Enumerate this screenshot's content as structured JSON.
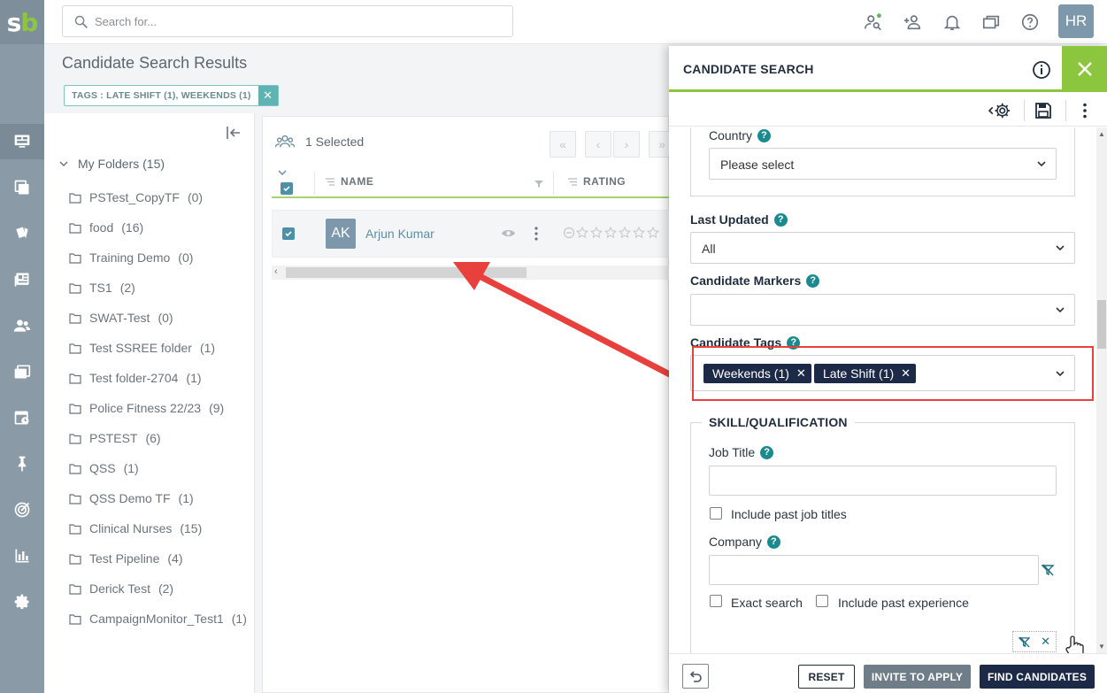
{
  "app": {
    "logo_text": "sb"
  },
  "header": {
    "search_placeholder": "Search for...",
    "user_initials": "HR",
    "icons": [
      "people-search-icon",
      "add-person-icon",
      "bell-icon",
      "windows-icon",
      "help-icon"
    ]
  },
  "nav": {
    "items": [
      "dashboard-icon",
      "copy-icon",
      "cards-icon",
      "news-icon",
      "people-icon",
      "folders-icon",
      "calendar-clock-icon",
      "pin-icon",
      "target-icon",
      "chart-icon",
      "gear-icon"
    ],
    "active_index": 0
  },
  "page": {
    "title": "Candidate Search Results",
    "filter_chip": "TAGS : LATE SHIFT (1), WEEKENDS (1)"
  },
  "folders": {
    "root_label": "My Folders",
    "root_count": "(15)",
    "items": [
      {
        "name": "PSTest_CopyTF",
        "count": "(0)"
      },
      {
        "name": "food",
        "count": "(16)"
      },
      {
        "name": "Training Demo",
        "count": "(0)"
      },
      {
        "name": "TS1",
        "count": "(2)"
      },
      {
        "name": "SWAT-Test",
        "count": "(0)"
      },
      {
        "name": "Test SSREE folder",
        "count": "(1)"
      },
      {
        "name": "Test folder-2704",
        "count": "(1)"
      },
      {
        "name": "Police Fitness 22/23",
        "count": "(9)"
      },
      {
        "name": "PSTEST",
        "count": "(6)"
      },
      {
        "name": "QSS",
        "count": "(1)"
      },
      {
        "name": "QSS Demo TF",
        "count": "(1)"
      },
      {
        "name": "Clinical Nurses",
        "count": "(15)"
      },
      {
        "name": "Test Pipeline",
        "count": "(4)"
      },
      {
        "name": "Derick Test",
        "count": "(2)"
      },
      {
        "name": "CampaignMonitor_Test1",
        "count": "(1)"
      }
    ]
  },
  "results": {
    "selected_text": "1 Selected",
    "columns": {
      "name": "NAME",
      "rating": "RATING"
    },
    "rows": [
      {
        "initials": "AK",
        "name": "Arjun Kumar",
        "rating_stars": 0,
        "checked": true
      }
    ]
  },
  "drawer": {
    "title": "CANDIDATE SEARCH",
    "country_label": "Country",
    "country_value": "Please select",
    "last_updated_label": "Last Updated",
    "last_updated_value": "All",
    "markers_label": "Candidate Markers",
    "markers_value": "",
    "tags_label": "Candidate Tags",
    "tags": [
      "Weekends (1)",
      "Late Shift (1)"
    ],
    "skill_section": "SKILL/QUALIFICATION",
    "job_title_label": "Job Title",
    "job_title_value": "",
    "include_past_titles": "Include past job titles",
    "company_label": "Company",
    "company_value": "",
    "exact_search": "Exact search",
    "include_past_experience": "Include past experience",
    "help_glyph": "?",
    "remove_glyph": "✕"
  },
  "footer": {
    "reset": "RESET",
    "invite": "INVITE TO APPLY",
    "find": "FIND CANDIDATES"
  },
  "colors": {
    "accent_green": "#8cc63f",
    "navy": "#1c2a48",
    "teal": "#1a8a8f",
    "highlight_red": "#e8413d"
  }
}
